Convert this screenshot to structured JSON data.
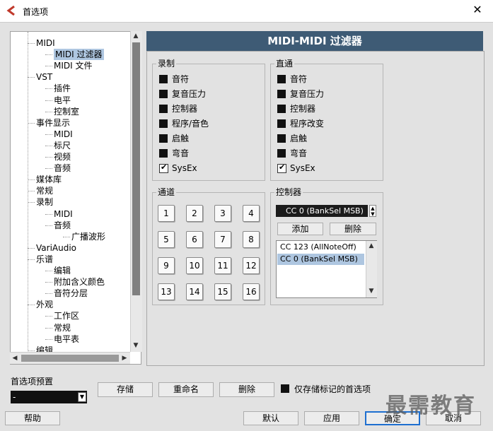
{
  "window": {
    "title": "首选项",
    "close": "✕"
  },
  "tree": {
    "items": [
      {
        "label": "MIDI",
        "level": 1
      },
      {
        "label": "MIDI 过滤器",
        "level": 2,
        "selected": true
      },
      {
        "label": "MIDI 文件",
        "level": 2
      },
      {
        "label": "VST",
        "level": 1
      },
      {
        "label": "插件",
        "level": 2
      },
      {
        "label": "电平",
        "level": 2
      },
      {
        "label": "控制室",
        "level": 2
      },
      {
        "label": "事件显示",
        "level": 1
      },
      {
        "label": "MIDI",
        "level": 2
      },
      {
        "label": "标尺",
        "level": 2
      },
      {
        "label": "视频",
        "level": 2
      },
      {
        "label": "音频",
        "level": 2
      },
      {
        "label": "媒体库",
        "level": 1
      },
      {
        "label": "常规",
        "level": 1
      },
      {
        "label": "录制",
        "level": 1
      },
      {
        "label": "MIDI",
        "level": 2
      },
      {
        "label": "音频",
        "level": 2
      },
      {
        "label": "广播波形",
        "level": 3
      },
      {
        "label": "VariAudio",
        "level": 1
      },
      {
        "label": "乐谱",
        "level": 1
      },
      {
        "label": "编辑",
        "level": 2
      },
      {
        "label": "附加含义颜色",
        "level": 2
      },
      {
        "label": "音符分层",
        "level": 2
      },
      {
        "label": "外观",
        "level": 1
      },
      {
        "label": "工作区",
        "level": 2
      },
      {
        "label": "常规",
        "level": 2
      },
      {
        "label": "电平表",
        "level": 2
      },
      {
        "label": "编辑",
        "level": 1
      }
    ]
  },
  "panel": {
    "title": "MIDI-MIDI 过滤器",
    "record": {
      "label": "录制",
      "items": [
        {
          "label": "音符",
          "checked": false
        },
        {
          "label": "复音压力",
          "checked": false
        },
        {
          "label": "控制器",
          "checked": false
        },
        {
          "label": "程序/音色",
          "checked": false
        },
        {
          "label": "启触",
          "checked": false
        },
        {
          "label": "弯音",
          "checked": false
        },
        {
          "label": "SysEx",
          "checked": true
        }
      ]
    },
    "thru": {
      "label": "直通",
      "items": [
        {
          "label": "音符",
          "checked": false
        },
        {
          "label": "复音压力",
          "checked": false
        },
        {
          "label": "控制器",
          "checked": false
        },
        {
          "label": "程序改变",
          "checked": false
        },
        {
          "label": "启触",
          "checked": false
        },
        {
          "label": "弯音",
          "checked": false
        },
        {
          "label": "SysEx",
          "checked": true
        }
      ]
    },
    "channels": {
      "label": "通道",
      "buttons": [
        "1",
        "2",
        "3",
        "4",
        "5",
        "6",
        "7",
        "8",
        "9",
        "10",
        "11",
        "12",
        "13",
        "14",
        "15",
        "16"
      ]
    },
    "controller": {
      "label": "控制器",
      "selected": "CC 0  (BankSel MSB)",
      "add": "添加",
      "remove": "删除",
      "list": [
        {
          "label": "CC 123  (AllNoteOff)",
          "selected": false
        },
        {
          "label": "CC 0  (BankSel MSB)",
          "selected": true
        }
      ]
    }
  },
  "presets": {
    "label": "首选项预置",
    "value": "-",
    "store": "存储",
    "rename": "重命名",
    "delete": "删除",
    "only_marked": "仅存储标记的首选项",
    "only_marked_checked": false
  },
  "footer": {
    "help": "帮助",
    "default": "默认",
    "apply": "应用",
    "ok": "确定",
    "cancel": "取消"
  },
  "watermark": "最需教育",
  "colors": {
    "header_bg": "#3e5b75",
    "selection": "#aec6e0",
    "accent_border": "#1e6fd0"
  }
}
